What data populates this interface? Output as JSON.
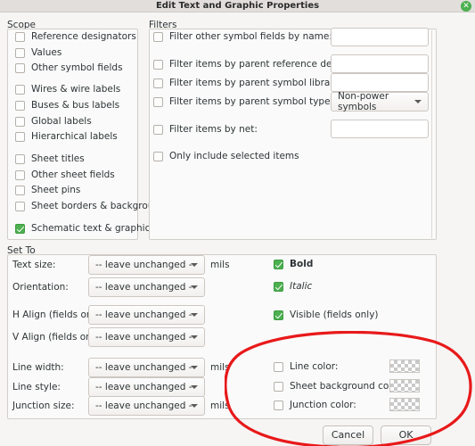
{
  "window": {
    "title": "Edit Text and Graphic Properties",
    "close_icon": "close-icon"
  },
  "scope": {
    "label": "Scope",
    "items": [
      {
        "label": "Reference designators",
        "checked": false
      },
      {
        "label": "Values",
        "checked": false
      },
      {
        "label": "Other symbol fields",
        "checked": false
      },
      {
        "label": "Wires & wire labels",
        "checked": false
      },
      {
        "label": "Buses & bus labels",
        "checked": false
      },
      {
        "label": "Global labels",
        "checked": false
      },
      {
        "label": "Hierarchical labels",
        "checked": false
      },
      {
        "label": "Sheet titles",
        "checked": false
      },
      {
        "label": "Other sheet fields",
        "checked": false
      },
      {
        "label": "Sheet pins",
        "checked": false
      },
      {
        "label": "Sheet borders & backgrounds",
        "checked": false
      },
      {
        "label": "Schematic text & graphics",
        "checked": true
      }
    ]
  },
  "filters": {
    "label": "Filters",
    "rows": [
      {
        "label": "Filter other symbol fields by name:",
        "checked": false,
        "value": "",
        "type": "entry"
      },
      {
        "label": "Filter items by parent reference designator:",
        "checked": false,
        "value": "",
        "type": "entry"
      },
      {
        "label": "Filter items by parent symbol library id:",
        "checked": false,
        "value": "",
        "type": "entry"
      },
      {
        "label": "Filter items by parent symbol type:",
        "checked": false,
        "value": "Non-power symbols",
        "type": "combo"
      },
      {
        "label": "Filter items by net:",
        "checked": false,
        "value": "",
        "type": "entry"
      },
      {
        "label": "Only include selected items",
        "checked": false,
        "value": "",
        "type": "none"
      }
    ]
  },
  "set_to": {
    "label": "Set To",
    "fields": [
      {
        "label": "Text size:",
        "value": "-- leave unchanged --",
        "unit": "mils",
        "type": "combo"
      },
      {
        "label": "Orientation:",
        "value": "-- leave unchanged --",
        "unit": "",
        "type": "combo"
      },
      {
        "label": "H Align (fields only):",
        "value": "-- leave unchanged --",
        "unit": "",
        "type": "combo"
      },
      {
        "label": "V Align (fields only):",
        "value": "-- leave unchanged --",
        "unit": "",
        "type": "combo"
      },
      {
        "label": "Line width:",
        "value": "-- leave unchanged --",
        "unit": "mils",
        "type": "combo"
      },
      {
        "label": "Line style:",
        "value": "-- leave unchanged --",
        "unit": "",
        "type": "combo"
      },
      {
        "label": "Junction size:",
        "value": "-- leave unchanged --",
        "unit": "mils",
        "type": "combo"
      }
    ],
    "style_checks": [
      {
        "label": "Bold",
        "checked": true
      },
      {
        "label": "Italic",
        "checked": true
      },
      {
        "label": "Visible (fields only)",
        "checked": true
      }
    ],
    "color_checks": [
      {
        "label": "Line color:",
        "checked": false
      },
      {
        "label": "Sheet background color:",
        "checked": false
      },
      {
        "label": "Junction color:",
        "checked": false
      }
    ]
  },
  "buttons": {
    "cancel": "Cancel",
    "ok": "OK"
  },
  "annotation": {
    "color": "#e8191a",
    "shape": "ellipse"
  }
}
